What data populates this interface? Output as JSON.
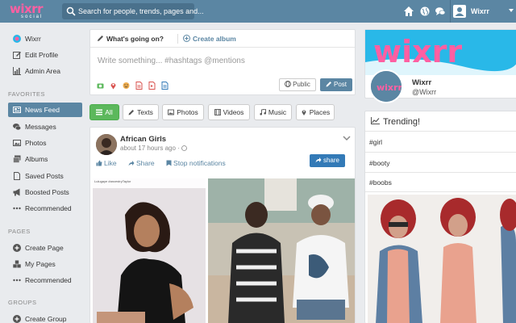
{
  "topbar": {
    "logo_text": "wixrr",
    "logo_sub": "social",
    "search_placeholder": "Search for people, trends, pages and...",
    "icons": [
      "home-icon",
      "globe-icon",
      "chat-icon",
      "users-icon"
    ],
    "user_name": "Wixrr"
  },
  "sidebar": {
    "profile_name": "Wixrr",
    "items_top": [
      {
        "label": "Edit Profile",
        "icon": "edit-icon"
      },
      {
        "label": "Admin Area",
        "icon": "chart-icon"
      }
    ],
    "favorites_heading": "FAVORITES",
    "favorites": [
      {
        "label": "News Feed",
        "icon": "newspaper-icon",
        "active": true
      },
      {
        "label": "Messages",
        "icon": "comments-icon"
      },
      {
        "label": "Photos",
        "icon": "image-icon"
      },
      {
        "label": "Albums",
        "icon": "album-icon"
      },
      {
        "label": "Saved Posts",
        "icon": "file-icon"
      },
      {
        "label": "Boosted Posts",
        "icon": "bullhorn-icon"
      },
      {
        "label": "Recommended",
        "icon": "ellipsis-icon"
      }
    ],
    "pages_heading": "PAGES",
    "pages": [
      {
        "label": "Create Page",
        "icon": "plus-circle-icon"
      },
      {
        "label": "My Pages",
        "icon": "cubes-icon"
      },
      {
        "label": "Recommended",
        "icon": "ellipsis-icon"
      }
    ],
    "groups_heading": "GROUPS",
    "groups": [
      {
        "label": "Create Group",
        "icon": "plus-circle-icon"
      }
    ]
  },
  "composer": {
    "tab_status": "What's going on?",
    "tab_album": "Create album",
    "placeholder": "Write something... #hashtags @mentions",
    "attach_icons": [
      "camera-icon",
      "location-icon",
      "emoji-icon",
      "file-pdf-icon",
      "video-file-icon",
      "document-icon"
    ],
    "public_label": "Public",
    "post_label": "Post"
  },
  "filters": [
    {
      "label": "All",
      "icon": "list-icon",
      "active": true
    },
    {
      "label": "Texts",
      "icon": "pencil-icon"
    },
    {
      "label": "Photos",
      "icon": "image-icon"
    },
    {
      "label": "Videos",
      "icon": "film-icon"
    },
    {
      "label": "Music",
      "icon": "music-icon"
    },
    {
      "label": "Places",
      "icon": "location-icon"
    }
  ],
  "post": {
    "author": "African Girls",
    "time": "about 17 hours ago",
    "like_label": "Like",
    "share_label": "Share",
    "stop_label": "Stop notifications",
    "share_button": "share",
    "overlay_caption": "Lulugaye  #ancestryTaylor"
  },
  "profile_card": {
    "banner_text": "wixrr",
    "name": "Wixrr",
    "handle": "@Wixrr"
  },
  "trending": {
    "title": "Trending!",
    "tags": [
      "#girl",
      "#booty",
      "#boobs"
    ]
  },
  "colors": {
    "brand": "#5b86a3",
    "logo_pink": "#ff5fa2",
    "active_filter": "#5cb85c",
    "share_button": "#337ab7",
    "banner": "#29b8e8"
  }
}
